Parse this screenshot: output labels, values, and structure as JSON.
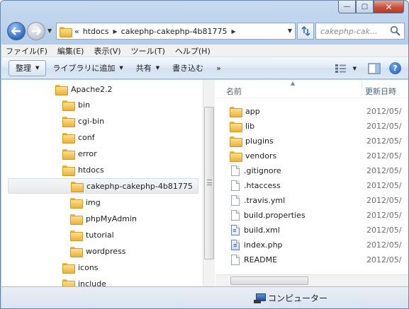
{
  "window": {
    "minimize_glyph": "—",
    "maximize_glyph": "▢",
    "close_glyph": "✕"
  },
  "address_bar": {
    "overflow_chevron": "«",
    "crumbs": [
      "htdocs",
      "cakephp-cakephp-4b81775"
    ],
    "search_placeholder": "cakephp-cak..."
  },
  "menu": [
    "ファイル(F)",
    "編集(E)",
    "表示(V)",
    "ツール(T)",
    "ヘルプ(H)"
  ],
  "toolbar": {
    "organize": "整理",
    "include_in_library": "ライブラリに追加",
    "share": "共有",
    "burn": "書き込む",
    "more": "»"
  },
  "tree": [
    {
      "label": "Apache2.2",
      "level": 0
    },
    {
      "label": "bin",
      "level": 1
    },
    {
      "label": "cgi-bin",
      "level": 1
    },
    {
      "label": "conf",
      "level": 1
    },
    {
      "label": "error",
      "level": 1
    },
    {
      "label": "htdocs",
      "level": 1
    },
    {
      "label": "cakephp-cakephp-4b81775",
      "level": 2,
      "selected": true
    },
    {
      "label": "img",
      "level": 2
    },
    {
      "label": "phpMyAdmin",
      "level": 2
    },
    {
      "label": "tutorial",
      "level": 2
    },
    {
      "label": "wordpress",
      "level": 2
    },
    {
      "label": "icons",
      "level": 1
    },
    {
      "label": "include",
      "level": 1
    }
  ],
  "columns": {
    "name": "名前",
    "date": "更新日時"
  },
  "files": [
    {
      "name": "app",
      "type": "folder",
      "date": "2012/05/"
    },
    {
      "name": "lib",
      "type": "folder",
      "date": "2012/05/"
    },
    {
      "name": "plugins",
      "type": "folder",
      "date": "2012/05/"
    },
    {
      "name": "vendors",
      "type": "folder",
      "date": "2012/05/"
    },
    {
      "name": ".gitignore",
      "type": "file",
      "date": "2012/05/"
    },
    {
      "name": ".htaccess",
      "type": "file",
      "date": "2012/05/"
    },
    {
      "name": ".travis.yml",
      "type": "file",
      "date": "2012/05/"
    },
    {
      "name": "build.properties",
      "type": "file",
      "date": "2012/05/"
    },
    {
      "name": "build.xml",
      "type": "xml",
      "date": "2012/05/"
    },
    {
      "name": "index.php",
      "type": "php",
      "date": "2012/05/"
    },
    {
      "name": "README",
      "type": "file",
      "date": "2012/05/"
    }
  ],
  "status": {
    "location": "コンピューター"
  }
}
